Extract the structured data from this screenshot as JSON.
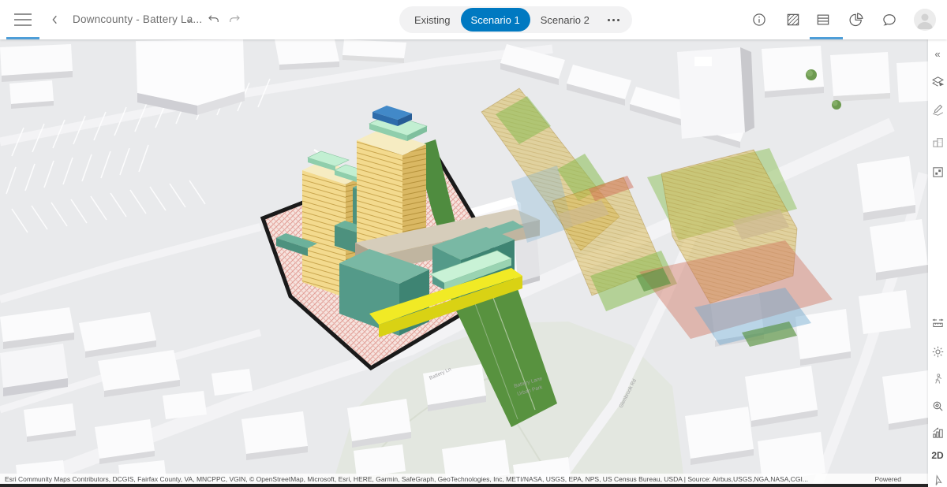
{
  "header": {
    "title": "Downcounty - Battery La...",
    "tabs": [
      {
        "label": "Existing",
        "active": false
      },
      {
        "label": "Scenario 1",
        "active": true
      },
      {
        "label": "Scenario 2",
        "active": false
      }
    ],
    "icons_left": [
      "menu",
      "back-chevron",
      "title-dropdown-caret",
      "undo",
      "redo"
    ],
    "icons_right": [
      "info",
      "zoning-overlay",
      "data-table",
      "pie-chart",
      "comments",
      "account-avatar"
    ],
    "active_right_icon": "data-table"
  },
  "sidebar": {
    "collapse_glyph": "«",
    "top_icons": [
      "plans",
      "edit-sketch",
      "buildings",
      "modify-grid"
    ],
    "bottom_icons": [
      "measure",
      "daylight",
      "pedestrian",
      "zoom-area",
      "capacity-metrics"
    ],
    "view_mode_label": "2D",
    "compass_icon": "north-pointer"
  },
  "map": {
    "labels": {
      "street_1": "Battery Ln",
      "park_line_1": "Battery Lane",
      "park_line_2": "Urban Park",
      "street_2": "Glenbrook Rd"
    },
    "attribution": "Esri Community Maps Contributors, DCGIS, Fairfax County, VA, MNCPPC, VGIN, © OpenStreetMap, Microsoft, Esri, HERE, Garmin, SafeGraph, GeoTechnologies, Inc, METI/NASA, USGS, EPA, NPS, US Census Bureau, USDA | Source: Airbus,USGS,NGA,NASA,CGI...",
    "powered": "Powered"
  },
  "colors": {
    "accent_blue": "#0079c1",
    "underline_blue": "#4e9ed8",
    "site_boundary": "#1a1a1a",
    "site_hatch_line": "#e09a92",
    "proposal_yellow": "#f3da8e",
    "proposal_teal": "#4d917e",
    "proposal_mint": "#c2efd2",
    "proposal_blue_roof": "#4289c8",
    "podium_yellow": "#f1ea25",
    "ghost_yellow": "#d8b750",
    "ghost_green": "#88bb52",
    "ghost_red": "#cf6d58",
    "ghost_blue": "#6aa6cf",
    "vegetation_green": "#58923f"
  }
}
